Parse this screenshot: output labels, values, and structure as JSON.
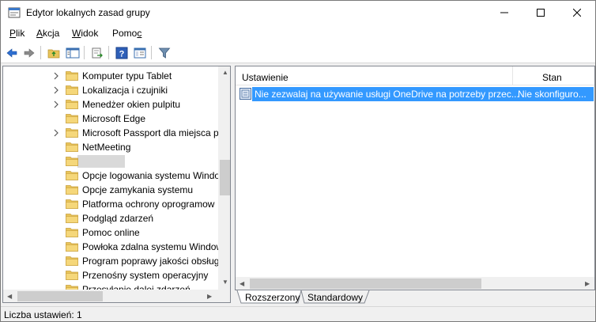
{
  "window": {
    "title": "Edytor lokalnych zasad grupy"
  },
  "menu": {
    "plik_prefix": "P",
    "plik_rest": "lik",
    "akcja_prefix": "A",
    "akcja_rest": "kcja",
    "widok_prefix": "W",
    "widok_rest": "idok",
    "pomoc_main": "Pomo",
    "pomoc_ul": "c"
  },
  "tree": {
    "items": [
      {
        "label": "Komputer typu Tablet",
        "expandable": true
      },
      {
        "label": "Lokalizacja i czujniki",
        "expandable": true
      },
      {
        "label": "Menedżer okien pulpitu",
        "expandable": true
      },
      {
        "label": "Microsoft Edge",
        "expandable": false
      },
      {
        "label": "Microsoft Passport dla miejsca p",
        "expandable": true
      },
      {
        "label": "NetMeeting",
        "expandable": false
      },
      {
        "label": "",
        "expandable": false,
        "selected": true
      },
      {
        "label": "Opcje logowania systemu Windo",
        "expandable": false
      },
      {
        "label": "Opcje zamykania systemu",
        "expandable": false
      },
      {
        "label": "Platforma ochrony oprogramow",
        "expandable": false
      },
      {
        "label": "Podgląd zdarzeń",
        "expandable": false
      },
      {
        "label": "Pomoc online",
        "expandable": false
      },
      {
        "label": "Powłoka zdalna systemu Window",
        "expandable": false
      },
      {
        "label": "Program poprawy jakości obsług",
        "expandable": false
      },
      {
        "label": "Przenośny system operacyjny",
        "expandable": false
      },
      {
        "label": "Przesyłanie dalej zdarzeń",
        "expandable": false
      }
    ]
  },
  "list": {
    "columns": {
      "setting": "Ustawienie",
      "state": "Stan"
    },
    "rows": [
      {
        "setting": "Nie zezwalaj na używanie usługi OneDrive na potrzeby przec...",
        "state": "Nie skonfiguro..."
      }
    ]
  },
  "tabs": {
    "extended": "Rozszerzony",
    "standard": "Standardowy"
  },
  "status": {
    "text": "Liczba ustawień: 1"
  },
  "colors": {
    "selection": "#3399ff",
    "folder": "#e8c45a"
  }
}
